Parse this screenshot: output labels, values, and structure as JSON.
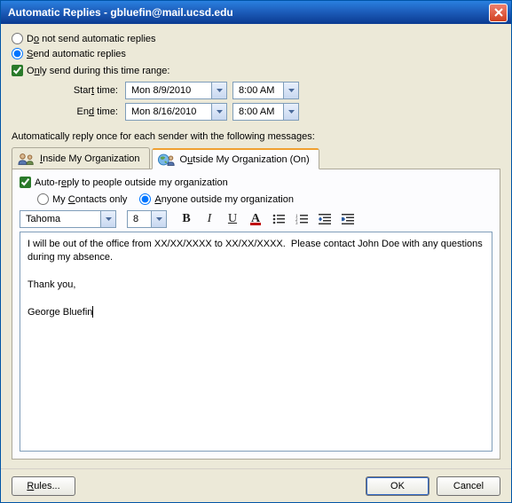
{
  "title": "Automatic Replies - gbluefin@mail.ucsd.edu",
  "radios": {
    "doNot": "Do not send automatic replies",
    "send": "Send automatic replies"
  },
  "timeRange": {
    "checkbox": "Only send during this time range:",
    "startLabel": "Start time:",
    "endLabel": "End time:",
    "startDate": "Mon 8/9/2010",
    "startTime": "8:00 AM",
    "endDate": "Mon 8/16/2010",
    "endTime": "8:00 AM"
  },
  "sectionText": "Automatically reply once for each sender with the following messages:",
  "tabs": {
    "inside": "Inside My Organization",
    "outside": "Outside My Organization (On)"
  },
  "outside": {
    "autoReplyCheck": "Auto-reply to people outside my organization",
    "contactsOnly": "My Contacts only",
    "anyone": "Anyone outside my organization"
  },
  "format": {
    "font": "Tahoma",
    "size": "8"
  },
  "message": "I will be out of the office from XX/XX/XXXX to XX/XX/XXXX.  Please contact John Doe with any questions during my absence.\n\nThank you,\n\nGeorge Bluefin",
  "buttons": {
    "rules": "Rules...",
    "ok": "OK",
    "cancel": "Cancel"
  }
}
